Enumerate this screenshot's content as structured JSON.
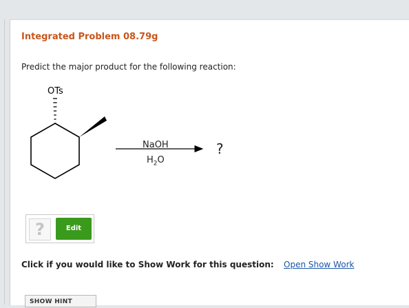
{
  "problem": {
    "title": "Integrated Problem 08.79g",
    "prompt": "Predict the major product for the following reaction:"
  },
  "reaction": {
    "leaving_group": "OTs",
    "reagent": "NaOH",
    "solvent": "H2O",
    "solvent_base": "H",
    "solvent_sub": "2",
    "solvent_end": "O",
    "product": "?"
  },
  "answer": {
    "placeholder_icon": "?",
    "edit_label": "Edit"
  },
  "work": {
    "question": "Click if you would like to Show Work for this question:",
    "link": "Open Show Work"
  },
  "hint": {
    "label": "SHOW HINT"
  },
  "colors": {
    "title": "#c8561c",
    "edit_button": "#3a9a1c",
    "link": "#1a55a6"
  }
}
